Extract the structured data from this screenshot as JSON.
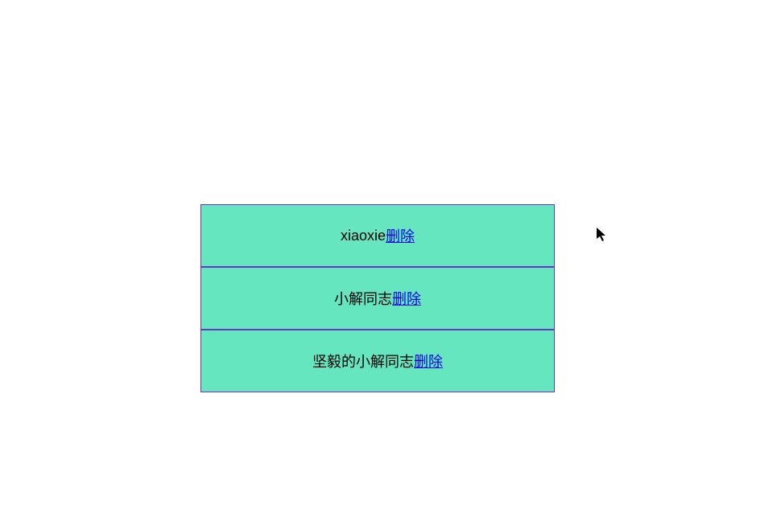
{
  "list": {
    "items": [
      {
        "text": "xiaoxie",
        "delete_label": "删除"
      },
      {
        "text": "小解同志",
        "delete_label": "删除"
      },
      {
        "text": "坚毅的小解同志",
        "delete_label": "删除"
      }
    ]
  }
}
